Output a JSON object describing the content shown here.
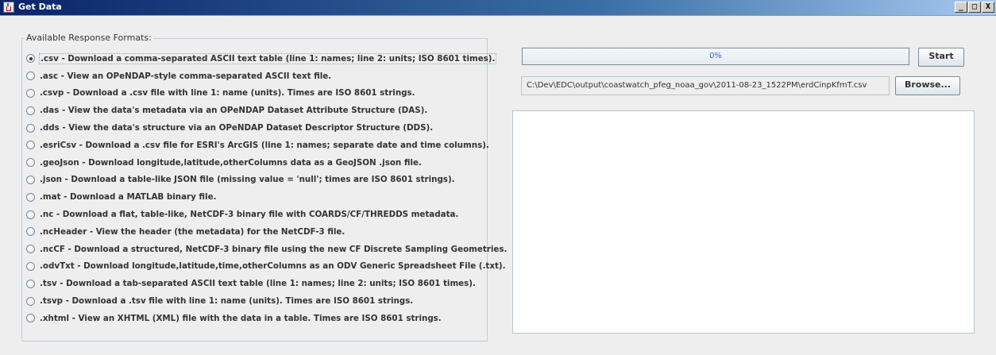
{
  "window": {
    "title": "Get Data",
    "controls": {
      "minimize": "_",
      "maximize": "□",
      "close": "X"
    }
  },
  "formats": {
    "group_label": "Available Response Formats:",
    "selected_index": 0,
    "items": [
      {
        "label": ".csv - Download a comma-separated ASCII text table (line 1: names; line 2: units; ISO 8601 times).",
        "checked": true
      },
      {
        "label": ".asc - View an OPeNDAP-style comma-separated ASCII text file.",
        "checked": false
      },
      {
        "label": ".csvp - Download a .csv file with line 1: name (units). Times are ISO 8601 strings.",
        "checked": false
      },
      {
        "label": ".das - View the data's metadata via an OPeNDAP Dataset Attribute Structure (DAS).",
        "checked": false
      },
      {
        "label": ".dds - View the data's structure via an OPeNDAP Dataset Descriptor Structure (DDS).",
        "checked": false
      },
      {
        "label": ".esriCsv - Download a .csv file for ESRI's ArcGIS (line 1: names; separate date and time columns).",
        "checked": false
      },
      {
        "label": ".geoJson - Download longitude,latitude,otherColumns data as a GeoJSON .json file.",
        "checked": false
      },
      {
        "label": ".json - Download a table-like JSON file (missing value = 'null'; times are ISO 8601 strings).",
        "checked": false
      },
      {
        "label": ".mat - Download a MATLAB binary file.",
        "checked": false
      },
      {
        "label": ".nc - Download a flat, table-like, NetCDF-3 binary file with COARDS/CF/THREDDS metadata.",
        "checked": false
      },
      {
        "label": ".ncHeader - View the header (the metadata) for the NetCDF-3 file.",
        "checked": false
      },
      {
        "label": ".ncCF - Download a structured, NetCDF-3 binary file using the new CF Discrete Sampling Geometries.",
        "checked": false
      },
      {
        "label": ".odvTxt - Download longitude,latitude,time,otherColumns as an ODV Generic Spreadsheet File (.txt).",
        "checked": false
      },
      {
        "label": ".tsv - Download a tab-separated ASCII text table (line 1: names; line 2: units; ISO 8601 times).",
        "checked": false
      },
      {
        "label": ".tsvp - Download a .tsv file with line 1: name (units). Times are ISO 8601 strings.",
        "checked": false
      },
      {
        "label": ".xhtml - View an XHTML (XML) file with the data in a table. Times are ISO 8601 strings.",
        "checked": false
      }
    ]
  },
  "progress": {
    "text": "0%",
    "value": 0
  },
  "start_label": "Start",
  "output_path": "C:\\Dev\\EDC\\output\\coastwatch_pfeg_noaa_gov\\2011-08-23_1522PM\\erdCinpKfmT.csv",
  "browse_label": "Browse..."
}
